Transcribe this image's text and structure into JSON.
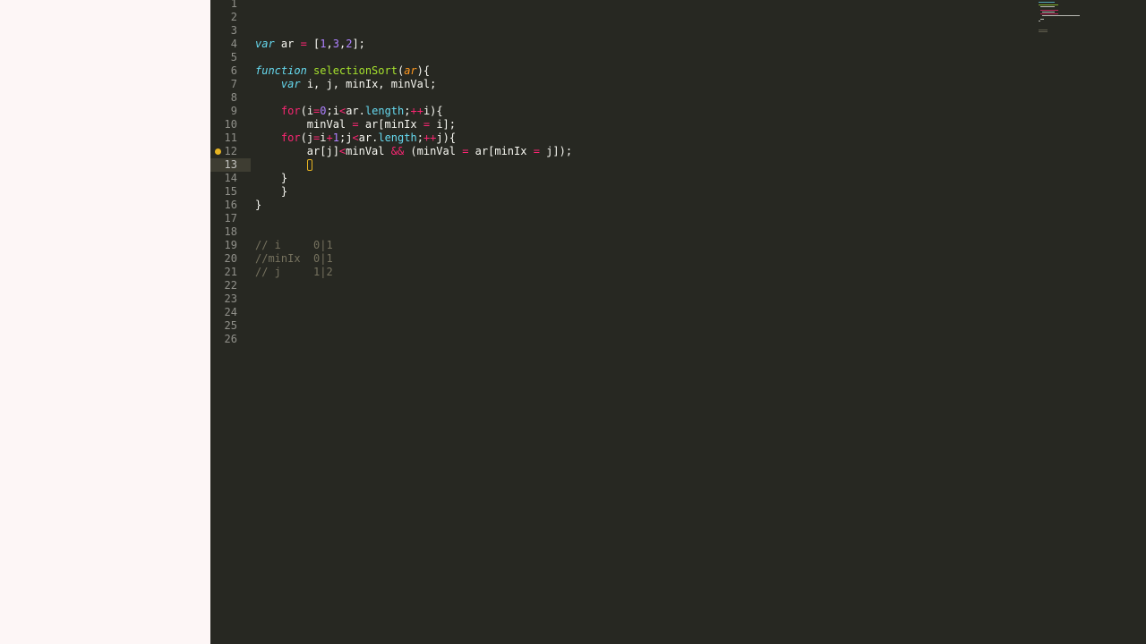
{
  "editor": {
    "current_line": 13,
    "breakpoint_line": 12,
    "lines": [
      {
        "n": "1",
        "tokens": []
      },
      {
        "n": "2",
        "tokens": []
      },
      {
        "n": "3",
        "tokens": []
      },
      {
        "n": "4",
        "tokens": [
          [
            "var",
            "kw"
          ],
          [
            " ar ",
            ""
          ],
          [
            "=",
            "op"
          ],
          [
            " [",
            ""
          ],
          [
            "1",
            "num"
          ],
          [
            ",",
            ""
          ],
          [
            "3",
            "num"
          ],
          [
            ",",
            ""
          ],
          [
            "2",
            "num"
          ],
          [
            "];",
            ""
          ]
        ]
      },
      {
        "n": "5",
        "tokens": []
      },
      {
        "n": "6",
        "tokens": [
          [
            "function",
            "kw"
          ],
          [
            " ",
            ""
          ],
          [
            "selectionSort",
            "fn"
          ],
          [
            "(",
            ""
          ],
          [
            "ar",
            "param"
          ],
          [
            "){",
            ""
          ]
        ]
      },
      {
        "n": "7",
        "tokens": [
          [
            "    ",
            ""
          ],
          [
            "var",
            "kw"
          ],
          [
            " i, j, minIx, minVal;",
            ""
          ]
        ]
      },
      {
        "n": "8",
        "tokens": []
      },
      {
        "n": "9",
        "tokens": [
          [
            "    ",
            ""
          ],
          [
            "for",
            "ctrl"
          ],
          [
            "(i",
            ""
          ],
          [
            "=",
            "op"
          ],
          [
            "0",
            "num"
          ],
          [
            ";i",
            ""
          ],
          [
            "<",
            "op"
          ],
          [
            "ar.",
            ""
          ],
          [
            "length",
            "prop"
          ],
          [
            ";",
            ""
          ],
          [
            "++",
            "op"
          ],
          [
            "i){",
            ""
          ]
        ]
      },
      {
        "n": "10",
        "tokens": [
          [
            "        minVal ",
            ""
          ],
          [
            "=",
            "op"
          ],
          [
            " ar[minIx ",
            ""
          ],
          [
            "=",
            "op"
          ],
          [
            " i];",
            ""
          ]
        ]
      },
      {
        "n": "11",
        "tokens": [
          [
            "    ",
            ""
          ],
          [
            "for",
            "ctrl"
          ],
          [
            "(j",
            ""
          ],
          [
            "=",
            "op"
          ],
          [
            "i",
            ""
          ],
          [
            "+",
            "op"
          ],
          [
            "1",
            "num"
          ],
          [
            ";j",
            ""
          ],
          [
            "<",
            "op"
          ],
          [
            "ar.",
            ""
          ],
          [
            "length",
            "prop"
          ],
          [
            ";",
            ""
          ],
          [
            "++",
            "op"
          ],
          [
            "j){",
            ""
          ]
        ]
      },
      {
        "n": "12",
        "tokens": [
          [
            "        ar[j]",
            ""
          ],
          [
            "<",
            "op"
          ],
          [
            "minVal ",
            ""
          ],
          [
            "&&",
            "op"
          ],
          [
            " (minVal ",
            ""
          ],
          [
            "=",
            "op"
          ],
          [
            " ar[minIx ",
            ""
          ],
          [
            "=",
            "op"
          ],
          [
            " j]);",
            ""
          ]
        ]
      },
      {
        "n": "13",
        "tokens": [
          [
            "        ",
            ""
          ]
        ],
        "cursor": true
      },
      {
        "n": "14",
        "tokens": [
          [
            "    }",
            ""
          ]
        ]
      },
      {
        "n": "15",
        "tokens": [
          [
            "    }",
            ""
          ]
        ]
      },
      {
        "n": "16",
        "tokens": [
          [
            "}",
            ""
          ]
        ]
      },
      {
        "n": "17",
        "tokens": []
      },
      {
        "n": "18",
        "tokens": []
      },
      {
        "n": "19",
        "tokens": [
          [
            "// i     0|1",
            "cmt"
          ]
        ]
      },
      {
        "n": "20",
        "tokens": [
          [
            "//minIx  0|1",
            "cmt"
          ]
        ]
      },
      {
        "n": "21",
        "tokens": [
          [
            "// j     1|2",
            "cmt"
          ]
        ]
      },
      {
        "n": "22",
        "tokens": []
      },
      {
        "n": "23",
        "tokens": []
      },
      {
        "n": "24",
        "tokens": []
      },
      {
        "n": "25",
        "tokens": []
      },
      {
        "n": "26",
        "tokens": []
      }
    ]
  },
  "colors": {
    "editor_bg": "#272822",
    "gutter_text": "#90908a",
    "keyword": "#66d9ef",
    "operator": "#f92672",
    "number": "#ae81ff",
    "function": "#a6e22e",
    "parameter": "#fd971f",
    "comment": "#75715e",
    "breakpoint": "#e6b422"
  }
}
